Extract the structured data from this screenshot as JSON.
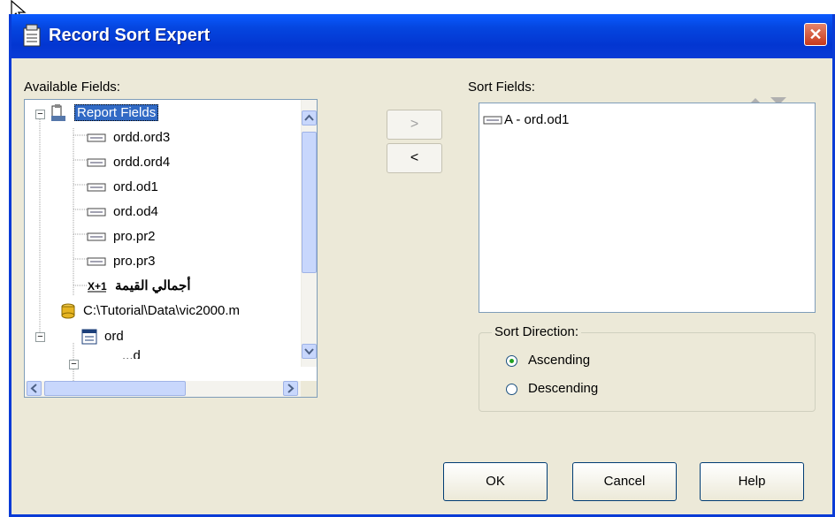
{
  "window": {
    "title": "Record Sort Expert",
    "close_label": "✕"
  },
  "available_fields": {
    "label": "Available Fields:",
    "tree": {
      "root_label": "Report Fields",
      "items": [
        "ordd.ord3",
        "ordd.ord4",
        "ord.od1",
        "ord.od4",
        "pro.pr2",
        "pro.pr3"
      ],
      "formula_label": "أجمالي القيمة",
      "db_label": "C:\\Tutorial\\Data\\vic2000.m",
      "table_label": "ord",
      "partial_label": "...d"
    }
  },
  "transfer": {
    "add_label": ">",
    "remove_label": "<"
  },
  "sort_fields": {
    "label": "Sort Fields:",
    "items": [
      "A - ord.od1"
    ]
  },
  "sort_direction": {
    "label": "Sort Direction:",
    "ascending_label": "Ascending",
    "descending_label": "Descending",
    "selected": "Ascending"
  },
  "buttons": {
    "ok": "OK",
    "cancel": "Cancel",
    "help": "Help"
  },
  "colors": {
    "title_blue": "#0a3bd6",
    "selection": "#316ac5",
    "dialog_bg": "#ece9d8",
    "close_red": "#c8391b"
  }
}
